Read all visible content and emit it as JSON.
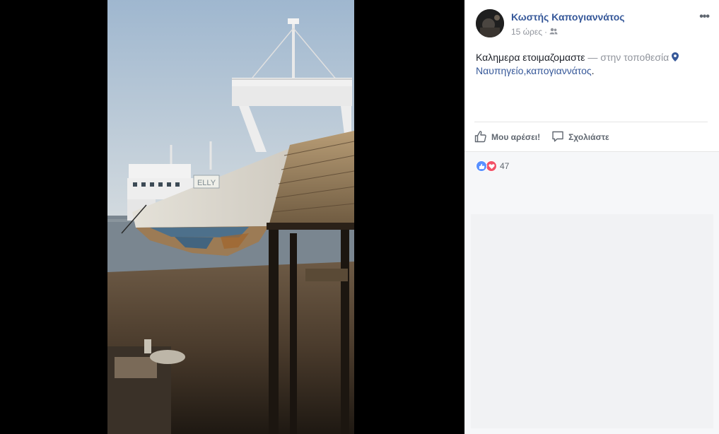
{
  "post": {
    "author": "Κωστής Καπογιαννάτος",
    "time": "15 ώρες",
    "separator": "·",
    "audience_icon": "friends-icon",
    "text": "Καλημερα ετοιμαζομαστε",
    "location_prefix": "— στην τοποθεσία",
    "location_icon": "map-pin-icon",
    "location_name": "Ναυπηγείο,καπογιαννάτος",
    "location_suffix": ".",
    "options_icon": "more-options-icon"
  },
  "actions": {
    "like_label": "Μου αρέσει!",
    "like_icon": "thumbs-up-icon",
    "comment_label": "Σχολιάστε",
    "comment_icon": "comment-icon"
  },
  "reactions": {
    "types": [
      "like",
      "love"
    ],
    "count": "47"
  },
  "photo": {
    "hull_text": "ELLY"
  },
  "colors": {
    "link": "#365899",
    "like": "#5890ff",
    "love": "#f25268"
  }
}
